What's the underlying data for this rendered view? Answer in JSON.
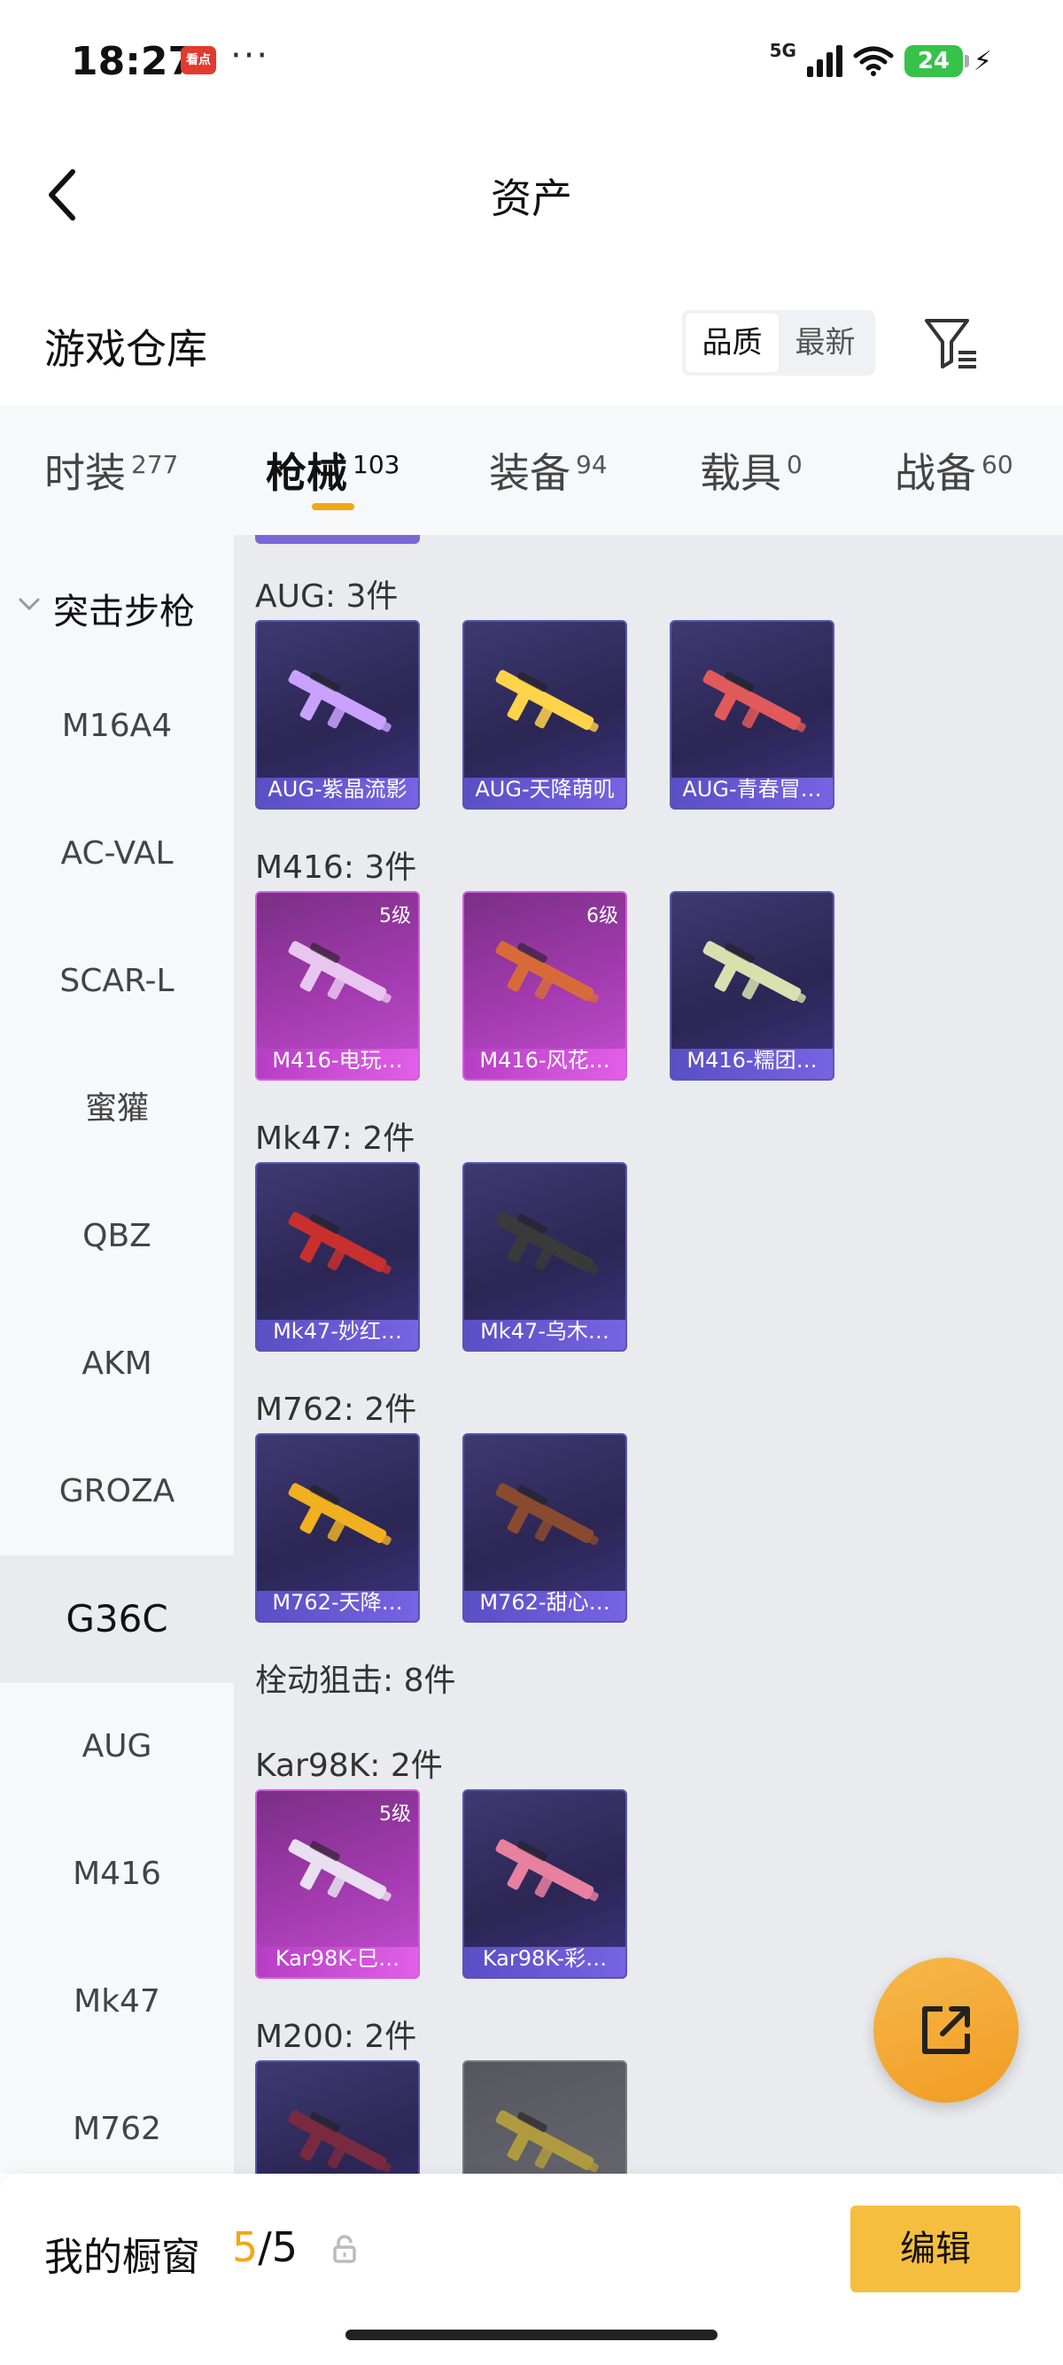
{
  "status_bar": {
    "time": "18:27",
    "app_badge": "看点",
    "more": "···",
    "network": "5G",
    "battery": "24",
    "battery_color": "#37c24a"
  },
  "header": {
    "title": "资产"
  },
  "warehouse": {
    "title": "游戏仓库",
    "sort_options": [
      "品质",
      "最新"
    ],
    "active_sort": "品质"
  },
  "category_tabs": [
    {
      "label": "时装",
      "count": "277"
    },
    {
      "label": "枪械",
      "count": "103"
    },
    {
      "label": "装备",
      "count": "94"
    },
    {
      "label": "载具",
      "count": "0"
    },
    {
      "label": "战备",
      "count": "60"
    }
  ],
  "active_tab": "枪械",
  "sidebar": {
    "group": "突击步枪",
    "items": [
      "M16A4",
      "AC-VAL",
      "SCAR-L",
      "蜜獾",
      "QBZ",
      "AKM",
      "GROZA",
      "G36C",
      "AUG",
      "M416",
      "Mk47",
      "M762"
    ],
    "active": "G36C"
  },
  "sections": [
    {
      "label": "AUG: 3件",
      "items": [
        {
          "name": "AUG-紫晶流影",
          "level": "",
          "rarity": "blue"
        },
        {
          "name": "AUG-天降萌叽",
          "level": "",
          "rarity": "blue"
        },
        {
          "name": "AUG-青春冒…",
          "level": "",
          "rarity": "blue"
        }
      ]
    },
    {
      "label": "M416: 3件",
      "items": [
        {
          "name": "M416-电玩…",
          "level": "5级",
          "rarity": "pink"
        },
        {
          "name": "M416-风花…",
          "level": "6级",
          "rarity": "pink"
        },
        {
          "name": "M416-糯团…",
          "level": "",
          "rarity": "blue"
        }
      ]
    },
    {
      "label": "Mk47: 2件",
      "items": [
        {
          "name": "Mk47-妙红…",
          "level": "",
          "rarity": "blue"
        },
        {
          "name": "Mk47-乌木…",
          "level": "",
          "rarity": "blue"
        }
      ]
    },
    {
      "label": "M762: 2件",
      "items": [
        {
          "name": "M762-天降…",
          "level": "",
          "rarity": "blue"
        },
        {
          "name": "M762-甜心…",
          "level": "",
          "rarity": "blue"
        }
      ]
    },
    {
      "label": "栓动狙击: 8件",
      "items": []
    },
    {
      "label": "Kar98K: 2件",
      "items": [
        {
          "name": "Kar98K-巳…",
          "level": "5级",
          "rarity": "pink"
        },
        {
          "name": "Kar98K-彩…",
          "level": "",
          "rarity": "blue"
        }
      ]
    },
    {
      "label": "M200: 2件",
      "items": [
        {
          "name": "",
          "level": "",
          "rarity": "blue"
        },
        {
          "name": "",
          "level": "",
          "rarity": "gray"
        }
      ]
    }
  ],
  "showcase": {
    "label": "我的橱窗",
    "current": "5",
    "separator": "/",
    "total": "5",
    "edit_label": "编辑"
  },
  "accent_color": "#f2a716"
}
